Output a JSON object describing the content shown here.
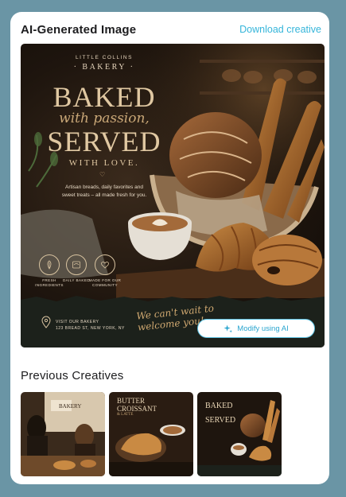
{
  "header": {
    "title": "AI-Generated Image",
    "download_label": "Download creative"
  },
  "creative": {
    "brand_small": "LITTLE COLLINS",
    "brand_big": "· BAKERY ·",
    "headline_1": "BAKED",
    "headline_script": "with passion,",
    "headline_2": "SERVED",
    "headline_3": "WITH LOVE.",
    "tagline": "Artisan breads, daily favorites and sweet treats – all made fresh for you.",
    "features": [
      {
        "label": "FRESH INGREDIENTS",
        "icon": "leaf-icon"
      },
      {
        "label": "DAILY BAKED",
        "icon": "oven-icon"
      },
      {
        "label": "MADE FOR OUR COMMUNITY",
        "icon": "heart-icon"
      }
    ],
    "visit_line_1": "VISIT OUR BAKERY",
    "visit_line_2": "123 BREAD ST, NEW YORK, NY",
    "footer_script": "We can't wait to welcome you!",
    "modify_label": "Modify using AI"
  },
  "previous": {
    "title": "Previous Creatives",
    "thumbs": [
      {
        "text": "BAKERY"
      },
      {
        "text": "BUTTER CROISSANT",
        "sub": "& LATTE"
      },
      {
        "text": "BAKED",
        "sub": "SERVED"
      }
    ]
  },
  "colors": {
    "frame": "#6a95a5",
    "accent": "#35b5da",
    "poster_gold": "#e0c8a2"
  }
}
